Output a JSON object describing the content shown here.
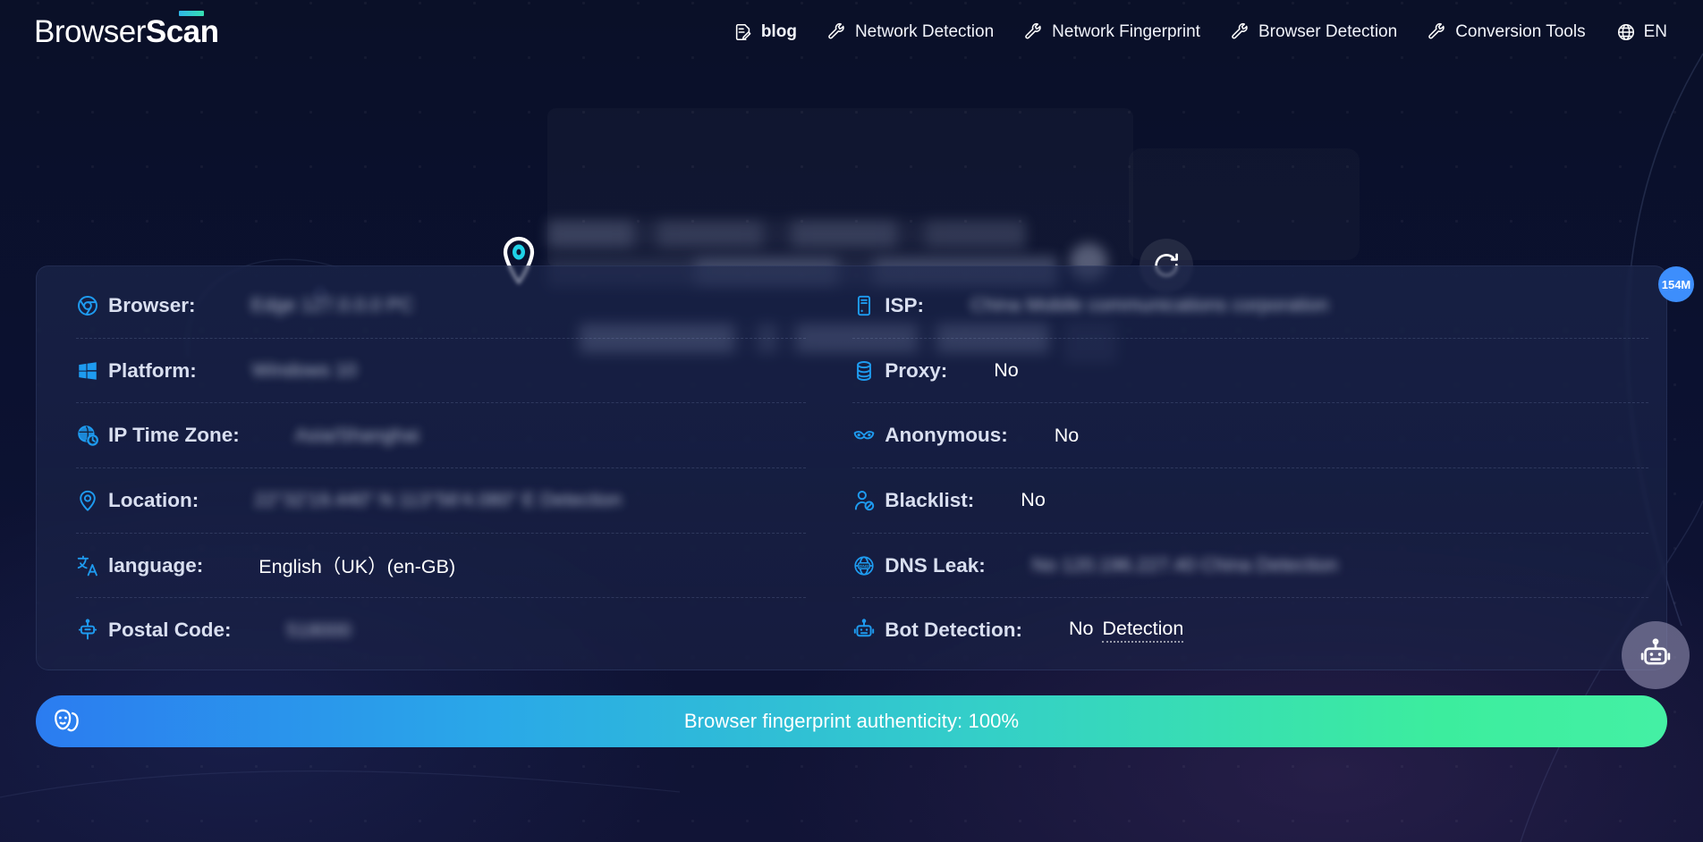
{
  "brand": {
    "logo_light": "Browser",
    "logo_bold": "Scan"
  },
  "nav": {
    "items": [
      {
        "label": "blog",
        "icon": "document-pencil-icon",
        "bold": true
      },
      {
        "label": "Network Detection",
        "icon": "wrench-icon",
        "bold": false
      },
      {
        "label": "Network Fingerprint",
        "icon": "wrench-icon",
        "bold": false
      },
      {
        "label": "Browser Detection",
        "icon": "wrench-icon",
        "bold": false
      },
      {
        "label": "Conversion Tools",
        "icon": "wrench-icon",
        "bold": false
      },
      {
        "label": "EN",
        "icon": "globe-icon",
        "bold": false
      }
    ]
  },
  "hero": {
    "pin_icon": "location-pin-icon",
    "ip_address": "",
    "geo_text": "guangdong / Chinese mainland",
    "refresh_icon": "refresh-icon",
    "refresh_label": ""
  },
  "badge": {
    "label": "154M"
  },
  "card": {
    "left_rows": [
      {
        "icon": "chrome-browser-icon",
        "label": "Browser:",
        "value": "Edge 127.0.0.0 PC",
        "blurred": true
      },
      {
        "icon": "windows-icon",
        "label": "Platform:",
        "value": "Windows 10",
        "blurred": true
      },
      {
        "icon": "globe-clock-icon",
        "label": "IP Time Zone:",
        "value": "Asia/Shanghai",
        "blurred": true
      },
      {
        "icon": "map-pin-icon",
        "label": "Location:",
        "value": "22°32'19.440\" N 113°56'4.080\" E Detection",
        "blurred": true
      },
      {
        "icon": "translate-icon",
        "label": "language:",
        "value": "English（UK）(en-GB)",
        "blurred": false
      },
      {
        "icon": "mailbox-icon",
        "label": "Postal Code:",
        "value": "518000",
        "blurred": true
      }
    ],
    "right_rows": [
      {
        "icon": "server-icon",
        "label": "ISP:",
        "value": "China Mobile communications corporation",
        "blurred": true
      },
      {
        "icon": "database-icon",
        "label": "Proxy:",
        "value": "No",
        "blurred": false
      },
      {
        "icon": "mask-icon",
        "label": "Anonymous:",
        "value": "No",
        "blurred": false
      },
      {
        "icon": "user-blocked-icon",
        "label": "Blacklist:",
        "value": "No",
        "blurred": false
      },
      {
        "icon": "dns-globe-icon",
        "label": "DNS Leak:",
        "value": "No  120.196.227.40  China  Detection",
        "blurred": true
      },
      {
        "icon": "robot-icon",
        "label": "Bot Detection:",
        "value_plain": "No",
        "value_dotted": "Detection",
        "blurred": false
      }
    ],
    "bot_fab_icon": "robot-chat-icon"
  },
  "auth": {
    "icon": "theater-masks-icon",
    "text": "Browser fingerprint authenticity: 100%",
    "percent": 100,
    "gradient_start": "#2b7cf0",
    "gradient_end": "#44f0a4"
  },
  "colors": {
    "background": "#0a1028",
    "card": "#1e2950",
    "accent": "#1e9bf0",
    "text": "#ffffff",
    "label": "#d9dff0"
  }
}
